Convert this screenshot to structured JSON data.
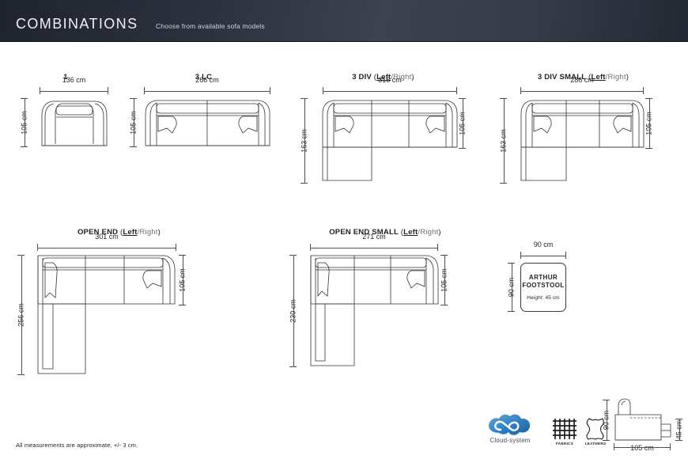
{
  "header": {
    "title": "COMBINATIONS",
    "subtitle": "Choose from available sofa models",
    "bg_dark": "#20242e",
    "bg_light": "#3c4250",
    "title_color": "#f0f1f3"
  },
  "models": [
    {
      "id": "single",
      "name": "1",
      "has_sides": false,
      "width_label": "136 cm",
      "depth_left_label": "105 cm",
      "shape": "single-seat"
    },
    {
      "id": "3lc",
      "name": "3 LC",
      "has_sides": false,
      "width_label": "266 cm",
      "depth_left_label": "105 cm",
      "shape": "straight-3"
    },
    {
      "id": "3div",
      "name": "3 DIV",
      "has_sides": true,
      "side_left": "Left",
      "side_sep": "/",
      "side_right": "Right",
      "width_label": "316 cm",
      "depth_left_label": "163 cm",
      "depth_right_label": "105 cm",
      "shape": "l-shape"
    },
    {
      "id": "3divsmall",
      "name": "3 DIV SMALL",
      "has_sides": true,
      "side_left": "Left",
      "side_sep": "/",
      "side_right": "Right",
      "width_label": "286 cm",
      "depth_left_label": "163 cm",
      "depth_right_label": "105 cm",
      "shape": "l-shape"
    },
    {
      "id": "openend",
      "name": "OPEN END",
      "has_sides": true,
      "side_left": "Left",
      "side_sep": "/",
      "side_right": "Right",
      "width_label": "301 cm",
      "depth_left_label": "256 cm",
      "depth_right_label": "105 cm",
      "shape": "open-end"
    },
    {
      "id": "openendsmall",
      "name": "OPEN END SMALL",
      "has_sides": true,
      "side_left": "Left",
      "side_sep": "/",
      "side_right": "Right",
      "width_label": "271 cm",
      "depth_left_label": "230 cm",
      "depth_right_label": "105 cm",
      "shape": "open-end"
    }
  ],
  "footstool": {
    "name_line1": "ARTHUR",
    "name_line2": "FOOTSTOOL",
    "height_note": "Height: 45 cm",
    "width_label": "90 cm",
    "depth_label": "90 cm"
  },
  "footer": {
    "note": "All measurements are approximate, +/- 3 cm.",
    "cloud_logo_label": "Cloud-system",
    "cloud_logo_color": "#2f7fc4",
    "fabrics_label": "FABRICS",
    "leathers_label": "LEATHERS",
    "profile": {
      "height_label": "90 cm",
      "stool_height_label": "45 cm",
      "depth_label": "105 cm"
    }
  }
}
